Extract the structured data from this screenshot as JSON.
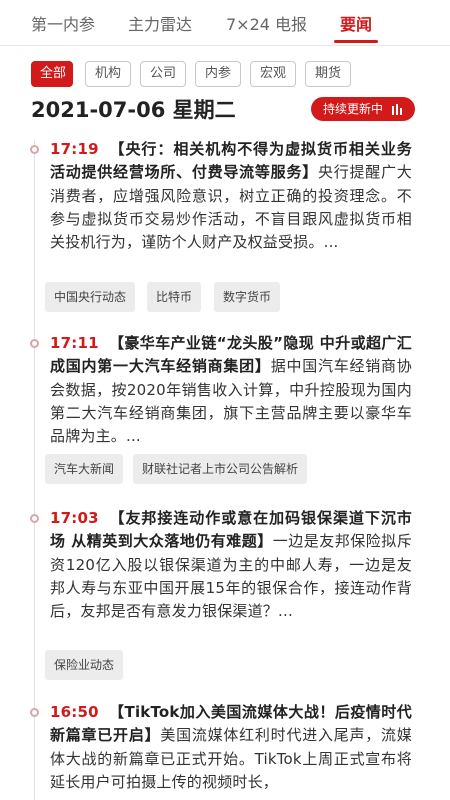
{
  "nav": {
    "tabs": [
      {
        "label": "第一内参"
      },
      {
        "label": "主力雷达"
      },
      {
        "label": "7×24 电报"
      },
      {
        "label": "要闻",
        "active": true
      }
    ]
  },
  "filters": {
    "chips": [
      {
        "label": "全部",
        "active": true
      },
      {
        "label": "机构"
      },
      {
        "label": "公司"
      },
      {
        "label": "内参"
      },
      {
        "label": "宏观"
      },
      {
        "label": "期货"
      }
    ]
  },
  "date_header": {
    "date": "2021-07-06 星期二",
    "live_button": "持续更新中"
  },
  "news": [
    {
      "time": "17:19",
      "headline": "【央行：相关机构不得为虚拟货币相关业务活动提供经营场所、付费导流等服务】",
      "body": "央行提醒广大消费者，应增强风险意识，树立正确的投资理念。不参与虚拟货币交易炒作活动，不盲目跟风虚拟货币相关投机行为，谨防个人财产及权益受损。...",
      "tags": [
        "中国央行动态",
        "比特币",
        "数字货币"
      ]
    },
    {
      "time": "17:11",
      "headline": "【豪华车产业链“龙头股”隐现 中升或超广汇成国内第一大汽车经销商集团】",
      "body": "据中国汽车经销商协会数据，按2020年销售收入计算，中升控股现为国内第二大汽车经销商集团，旗下主营品牌主要以豪华车品牌为主。...",
      "tags": [
        "汽车大新闻",
        "财联社记者上市公司公告解析"
      ]
    },
    {
      "time": "17:03",
      "headline": "【友邦接连动作或意在加码银保渠道下沉市场 从精英到大众落地仍有难题】",
      "body": "一边是友邦保险拟斥资120亿入股以银保渠道为主的中邮人寿，一边是友邦人寿与东亚中国开展15年的银保合作，接连动作背后，友邦是否有意发力银保渠道？...",
      "tags": [
        "保险业动态"
      ]
    },
    {
      "time": "16:50",
      "headline": "【TikTok加入美国流媒体大战！后疫情时代新篇章已开启】",
      "body": "美国流媒体红利时代进入尾声，流媒体大战的新篇章已正式开始。TikTok上周正式宣布将延长用户可拍摄上传的视频时长，",
      "tags": []
    }
  ]
}
